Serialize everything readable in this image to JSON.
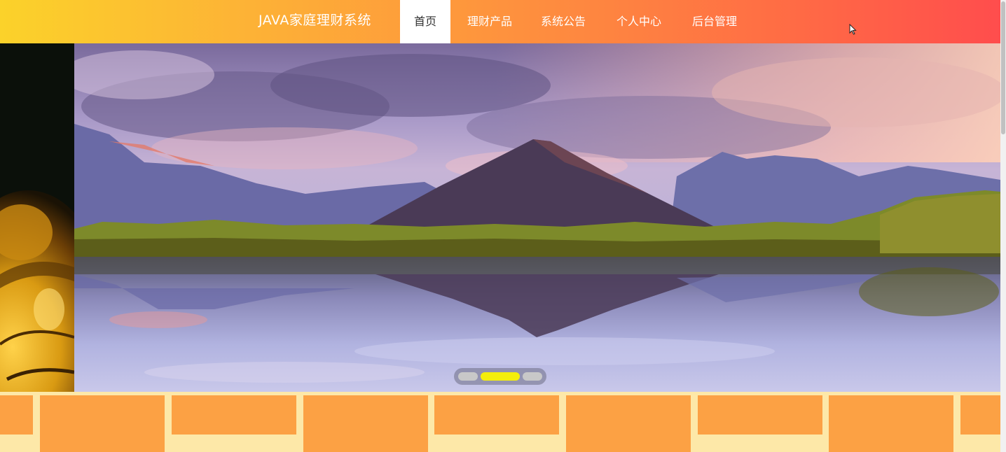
{
  "header": {
    "brand": "JAVA家庭理财系统",
    "nav": [
      {
        "label": "首页",
        "active": true
      },
      {
        "label": "理财产品",
        "active": false
      },
      {
        "label": "系统公告",
        "active": false
      },
      {
        "label": "个人中心",
        "active": false
      },
      {
        "label": "后台管理",
        "active": false
      }
    ]
  },
  "banner": {
    "slide_count": 3,
    "active_slide": 2
  },
  "colors": {
    "nav_gradient_start": "#fbd22a",
    "nav_gradient_end": "#ff4d4d",
    "active_dot": "#f4ee0b",
    "tile": "#fca144",
    "strip_background": "#fde8a8"
  },
  "tiles": {
    "count": 8
  }
}
